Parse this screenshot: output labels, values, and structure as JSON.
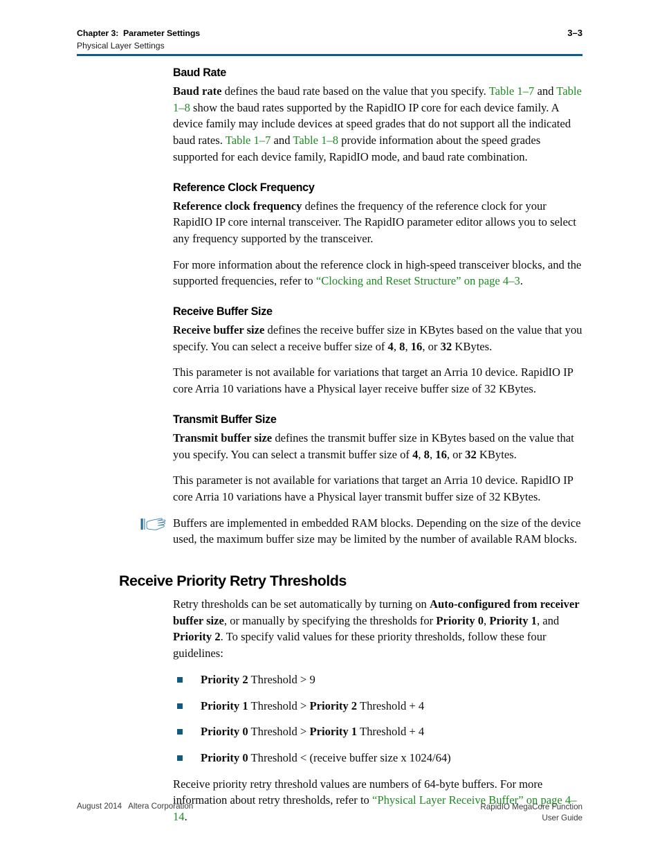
{
  "header": {
    "chapter": "Chapter 3:  Parameter Settings",
    "subtitle": "Physical Layer Settings",
    "page_number": "3–3",
    "rule_color": "#0a5c8c"
  },
  "colors": {
    "link_green": "#1e8a22",
    "rule_blue": "#0a5c8c",
    "bullet_blue": "#0f5a80",
    "note_icon_blue": "#2b6f9e"
  },
  "sections": {
    "baud_rate": {
      "heading": "Baud Rate",
      "p1": {
        "lead_bold": "Baud rate",
        "t1": " defines the baud rate based on the value that you specify. ",
        "link1": "Table 1–7",
        "t2": " and ",
        "link2": "Table 1–8",
        "t3": " show the baud rates supported by the RapidIO IP core for each device family. A device family may include devices at speed grades that do not support all the indicated baud rates. ",
        "link3": "Table 1–7",
        "t4": " and ",
        "link4": "Table 1–8",
        "t5": " provide information about the speed grades supported for each device family, RapidIO mode, and baud rate combination."
      }
    },
    "reference_clock_frequency": {
      "heading": "Reference Clock Frequency",
      "p1": {
        "lead_bold": "Reference clock frequency",
        "t1": " defines the frequency of the reference clock for your RapidIO IP core internal transceiver. The RapidIO parameter editor allows you to select any frequency supported by the transceiver."
      },
      "p2": {
        "t1": "For more information about the reference clock in high-speed transceiver blocks, and the supported frequencies, refer to ",
        "link1": "“Clocking and Reset Structure” on page 4–3",
        "t2": "."
      }
    },
    "receive_buffer_size": {
      "heading": "Receive Buffer Size",
      "p1": {
        "lead_bold": "Receive buffer size",
        "t1": " defines the receive buffer size in KBytes based on the value that you specify. You can select a receive buffer size of ",
        "v1": "4",
        "t2": ", ",
        "v2": "8",
        "t3": ", ",
        "v3": "16",
        "t4": ", or ",
        "v4": "32",
        "t5": " KBytes."
      },
      "p2": "This parameter is not available for variations that target an Arria 10 device.  RapidIO IP core Arria 10 variations have a Physical layer receive buffer size of 32 KBytes."
    },
    "transmit_buffer_size": {
      "heading": "Transmit Buffer Size",
      "p1": {
        "lead_bold": "Transmit buffer size",
        "t1": " defines the transmit buffer size in KBytes based on the value that you specify. You can select a transmit buffer size of ",
        "v1": "4",
        "t2": ", ",
        "v2": "8",
        "t3": ", ",
        "v3": "16",
        "t4": ", or ",
        "v4": "32",
        "t5": " KBytes."
      },
      "p2": "This parameter is not available for variations that target an Arria 10 device. RapidIO IP core Arria 10 variations have a Physical layer transmit buffer size of 32 KBytes."
    },
    "note": {
      "icon": "pointing-hand-icon",
      "text": "Buffers are implemented in embedded RAM blocks. Depending on the size of the device used, the maximum buffer size may be limited by the number of available RAM blocks."
    },
    "receive_priority_retry_thresholds": {
      "heading": "Receive Priority Retry Thresholds",
      "p1": {
        "t1": "Retry thresholds can be set automatically by turning on ",
        "b1": "Auto-configured from receiver buffer size",
        "t2": ", or manually by specifying the thresholds for ",
        "b2": "Priority 0",
        "t3": ", ",
        "b3": "Priority 1",
        "t4": ", and ",
        "b4": "Priority 2",
        "t5": ". To specify valid values for these priority thresholds, follow these four guidelines:"
      },
      "bullets": [
        {
          "b1": "Priority 2",
          "t1": " Threshold > 9",
          "b2": "",
          "t2": ""
        },
        {
          "b1": "Priority 1",
          "t1": " Threshold > ",
          "b2": "Priority 2",
          "t2": " Threshold + 4"
        },
        {
          "b1": "Priority 0",
          "t1": " Threshold > ",
          "b2": "Priority 1",
          "t2": " Threshold + 4"
        },
        {
          "b1": "Priority 0",
          "t1": " Threshold < (receive buffer size x 1024/64)",
          "b2": "",
          "t2": ""
        }
      ],
      "p2": {
        "t1": "Receive priority retry threshold values are numbers of 64-byte buffers. For more information about retry thresholds, refer to ",
        "link1": "“Physical Layer Receive Buffer” on page 4–14",
        "t2": "."
      }
    }
  },
  "footer": {
    "left": "August 2014   Altera Corporation",
    "right_line1": "RapidIO MegaCore Function",
    "right_line2": "User Guide"
  }
}
